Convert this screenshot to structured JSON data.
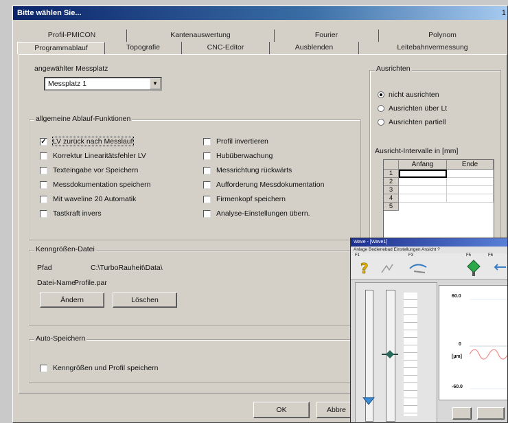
{
  "window": {
    "title": "Bitte wählen Sie...",
    "corner": "1"
  },
  "tabs": {
    "row1": [
      "Profil-PMICON",
      "Kantenauswertung",
      "Fourier",
      "Polynom"
    ],
    "row2": [
      "Programmablauf",
      "Topografie",
      "CNC-Editor",
      "Ausblenden",
      "Leitebahnvermessung"
    ],
    "active": "Programmablauf"
  },
  "messplatz": {
    "label": "angewählter Messplatz",
    "value": "Messplatz 1"
  },
  "ablauf": {
    "label": "allgemeine Ablauf-Funktionen",
    "left": [
      {
        "text": "LV zurück nach Messlauf",
        "checked": true,
        "focus": true
      },
      {
        "text": "Korrektur Linearitätsfehler LV",
        "checked": false
      },
      {
        "text": "Texteingabe vor Speichern",
        "checked": false
      },
      {
        "text": "Messdokumentation speichern",
        "checked": false
      },
      {
        "text": "Mit waveline 20 Automatik",
        "checked": false
      },
      {
        "text": "Tastkraft invers",
        "checked": false
      }
    ],
    "right": [
      {
        "text": "Profil invertieren",
        "checked": false
      },
      {
        "text": "Hubüberwachung",
        "checked": false
      },
      {
        "text": "Messrichtung rückwärts",
        "checked": false
      },
      {
        "text": "Aufforderung Messdokumentation",
        "checked": false
      },
      {
        "text": "Firmenkopf speichern",
        "checked": false
      },
      {
        "text": "Analyse-Einstellungen übern.",
        "checked": false
      }
    ]
  },
  "datei": {
    "label": "Kenngrößen-Datei",
    "pfad_label": "Pfad",
    "pfad_value": "C:\\TurboRauheit\\Data\\",
    "name_label": "Datei-Name",
    "name_value": "Profile.par",
    "aendern": "Ändern",
    "loeschen": "Löschen"
  },
  "auto": {
    "label": "Auto-Speichern",
    "option": "Kenngrößen und Profil speichern"
  },
  "ausrichten": {
    "label": "Ausrichten",
    "options": [
      "nicht ausrichten",
      "Ausrichten über Lt",
      "Ausrichten partiell"
    ],
    "selected": 0,
    "intervall_label": "Ausricht-Intervalle in   [mm]",
    "cols": [
      "Anfang",
      "Ende"
    ],
    "rows": [
      "1",
      "2",
      "3",
      "4",
      "5"
    ]
  },
  "footer": {
    "ok": "OK",
    "abbrechen": "Abbre"
  },
  "overlay": {
    "title": "Wave - [Wave1]",
    "menu": "Anlage  Bedienebad  Einstellungen  Ansicht  ?",
    "fkeys": [
      "F1",
      "F3",
      "F5",
      "F6"
    ],
    "ticks": [
      "60.0",
      "0",
      "[µm]",
      "-60.0"
    ]
  }
}
